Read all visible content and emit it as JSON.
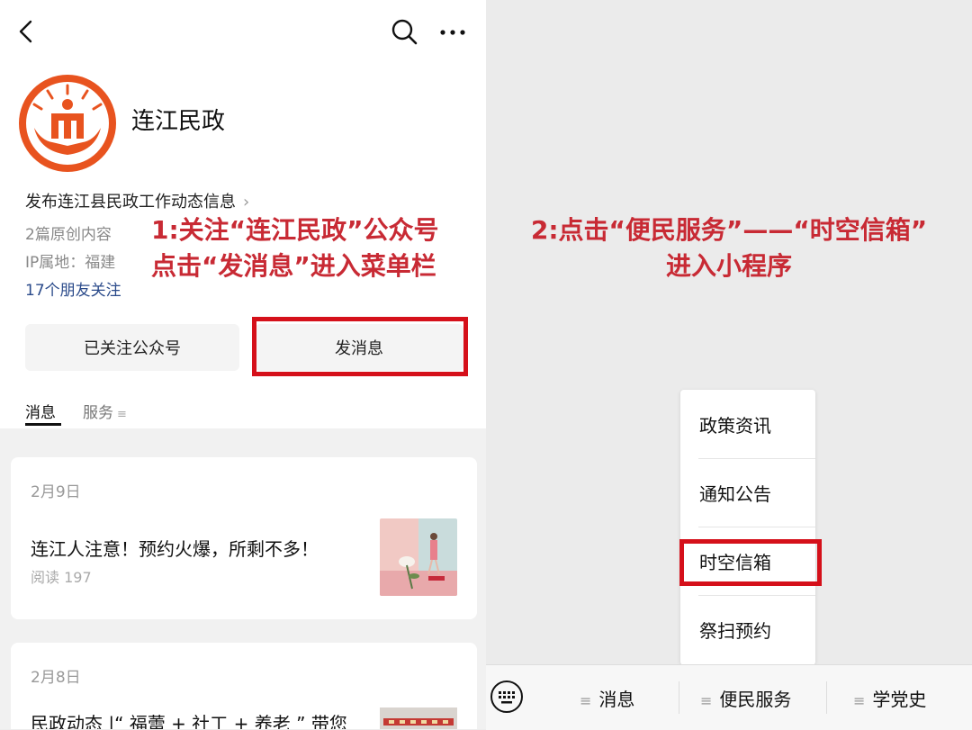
{
  "account": {
    "name": "连江民政",
    "description": "发布连江县民政工作动态信息",
    "original_count": "2篇原创内容",
    "ip_location": "IP属地：福建",
    "friends_following": "17个朋友关注"
  },
  "buttons": {
    "followed": "已关注公众号",
    "send_message": "发消息"
  },
  "tabs": {
    "messages": "消息",
    "services": "服务"
  },
  "annotations": {
    "step1_line1": "1:关注“连江民政”公众号",
    "step1_line2": "点击“发消息”进入菜单栏",
    "step2_line1": "2:点击“便民服务”——“时空信箱”",
    "step2_line2": "进入小程序"
  },
  "feed": [
    {
      "date": "2月9日",
      "title": "连江人注意！预约火爆，所剩不多！",
      "reads": "阅读 197"
    },
    {
      "date": "2月8日",
      "title": "民政动态 |“ 福蕾 + 社工 + 养老 ” 带您"
    }
  ],
  "service_menu": {
    "items": [
      "政策资讯",
      "通知公告",
      "时空信箱",
      "祭扫预约"
    ]
  },
  "bottom_bar": {
    "items": [
      "消息",
      "便民服务",
      "学党史"
    ]
  },
  "colors": {
    "annotation_red": "#c82a34",
    "highlight_box": "#d5101a",
    "logo_orange": "#e8531f",
    "link_blue": "#2a4a8a"
  }
}
